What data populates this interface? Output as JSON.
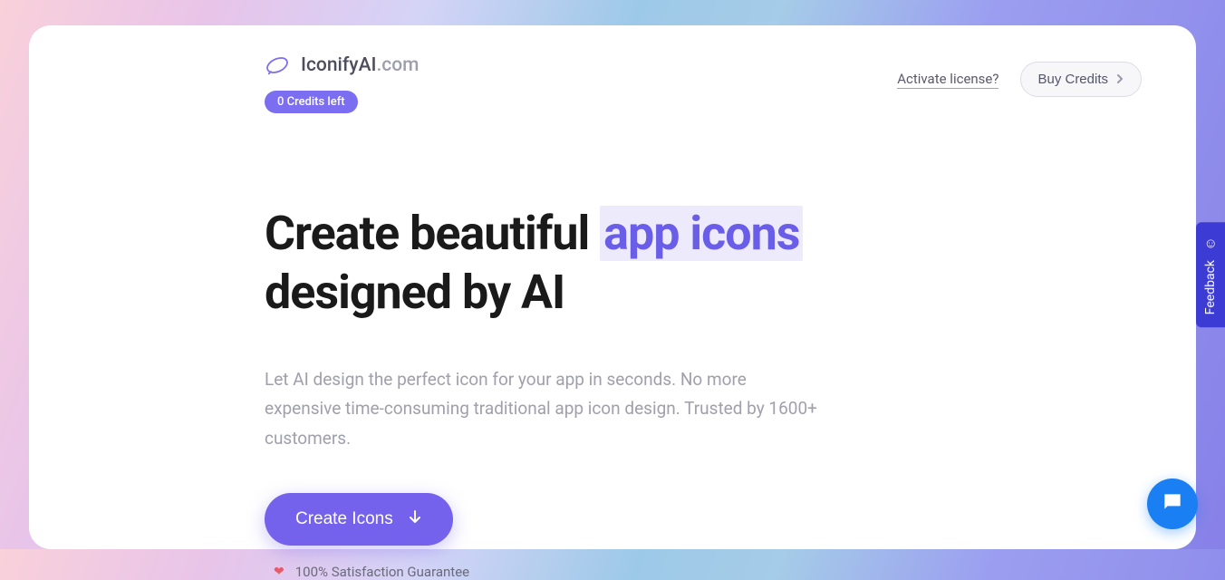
{
  "header": {
    "logo": {
      "brand": "IconifyAI",
      "domain": ".com"
    },
    "credits_badge": "0 Credits left",
    "activate_link": "Activate license?",
    "buy_credits": "Buy Credits"
  },
  "hero": {
    "title_part1": "Create beautiful ",
    "title_highlight": "app icons",
    "title_part2": " designed by AI",
    "subtitle": "Let AI design the perfect icon for your app in seconds. No more expensive time-consuming traditional app icon design. Trusted by 1600+ customers.",
    "cta_button": "Create Icons",
    "guarantee": "100% Satisfaction Guarantee"
  },
  "feedback": {
    "label": "Feedback"
  }
}
